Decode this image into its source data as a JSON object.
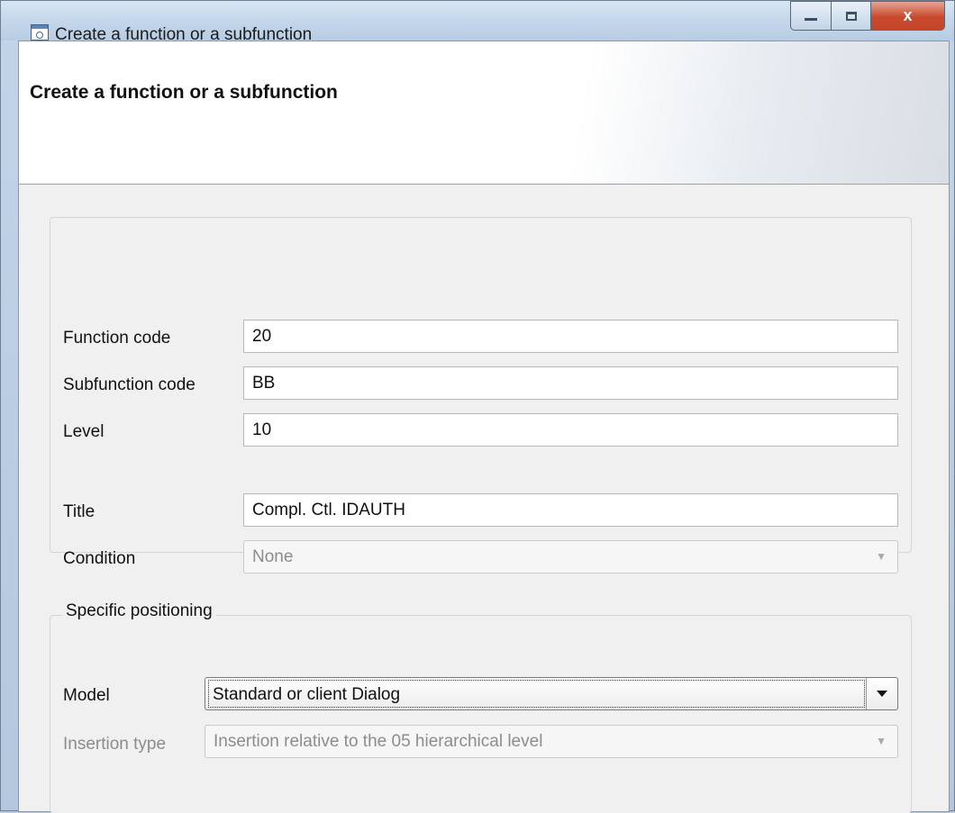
{
  "window": {
    "title": "Create a function or a subfunction",
    "close_glyph": "x"
  },
  "banner": {
    "title": "Create a function or a subfunction"
  },
  "form": {
    "function_code": {
      "label": "Function code",
      "value": "20"
    },
    "subfunction_code": {
      "label": "Subfunction code",
      "value": "BB"
    },
    "level": {
      "label": "Level",
      "value": "10"
    },
    "title": {
      "label": "Title",
      "value": "Compl. Ctl. IDAUTH"
    },
    "condition": {
      "label": "Condition",
      "value": "None"
    }
  },
  "positioning": {
    "legend": "Specific positioning",
    "model": {
      "label": "Model",
      "value": "Standard or client Dialog"
    },
    "insertion_type": {
      "label": "Insertion type",
      "value": "Insertion relative to the 05 hierarchical level"
    }
  },
  "icons": {
    "window_icon": "app-window-icon",
    "dropdown": "chevron-down-icon"
  }
}
